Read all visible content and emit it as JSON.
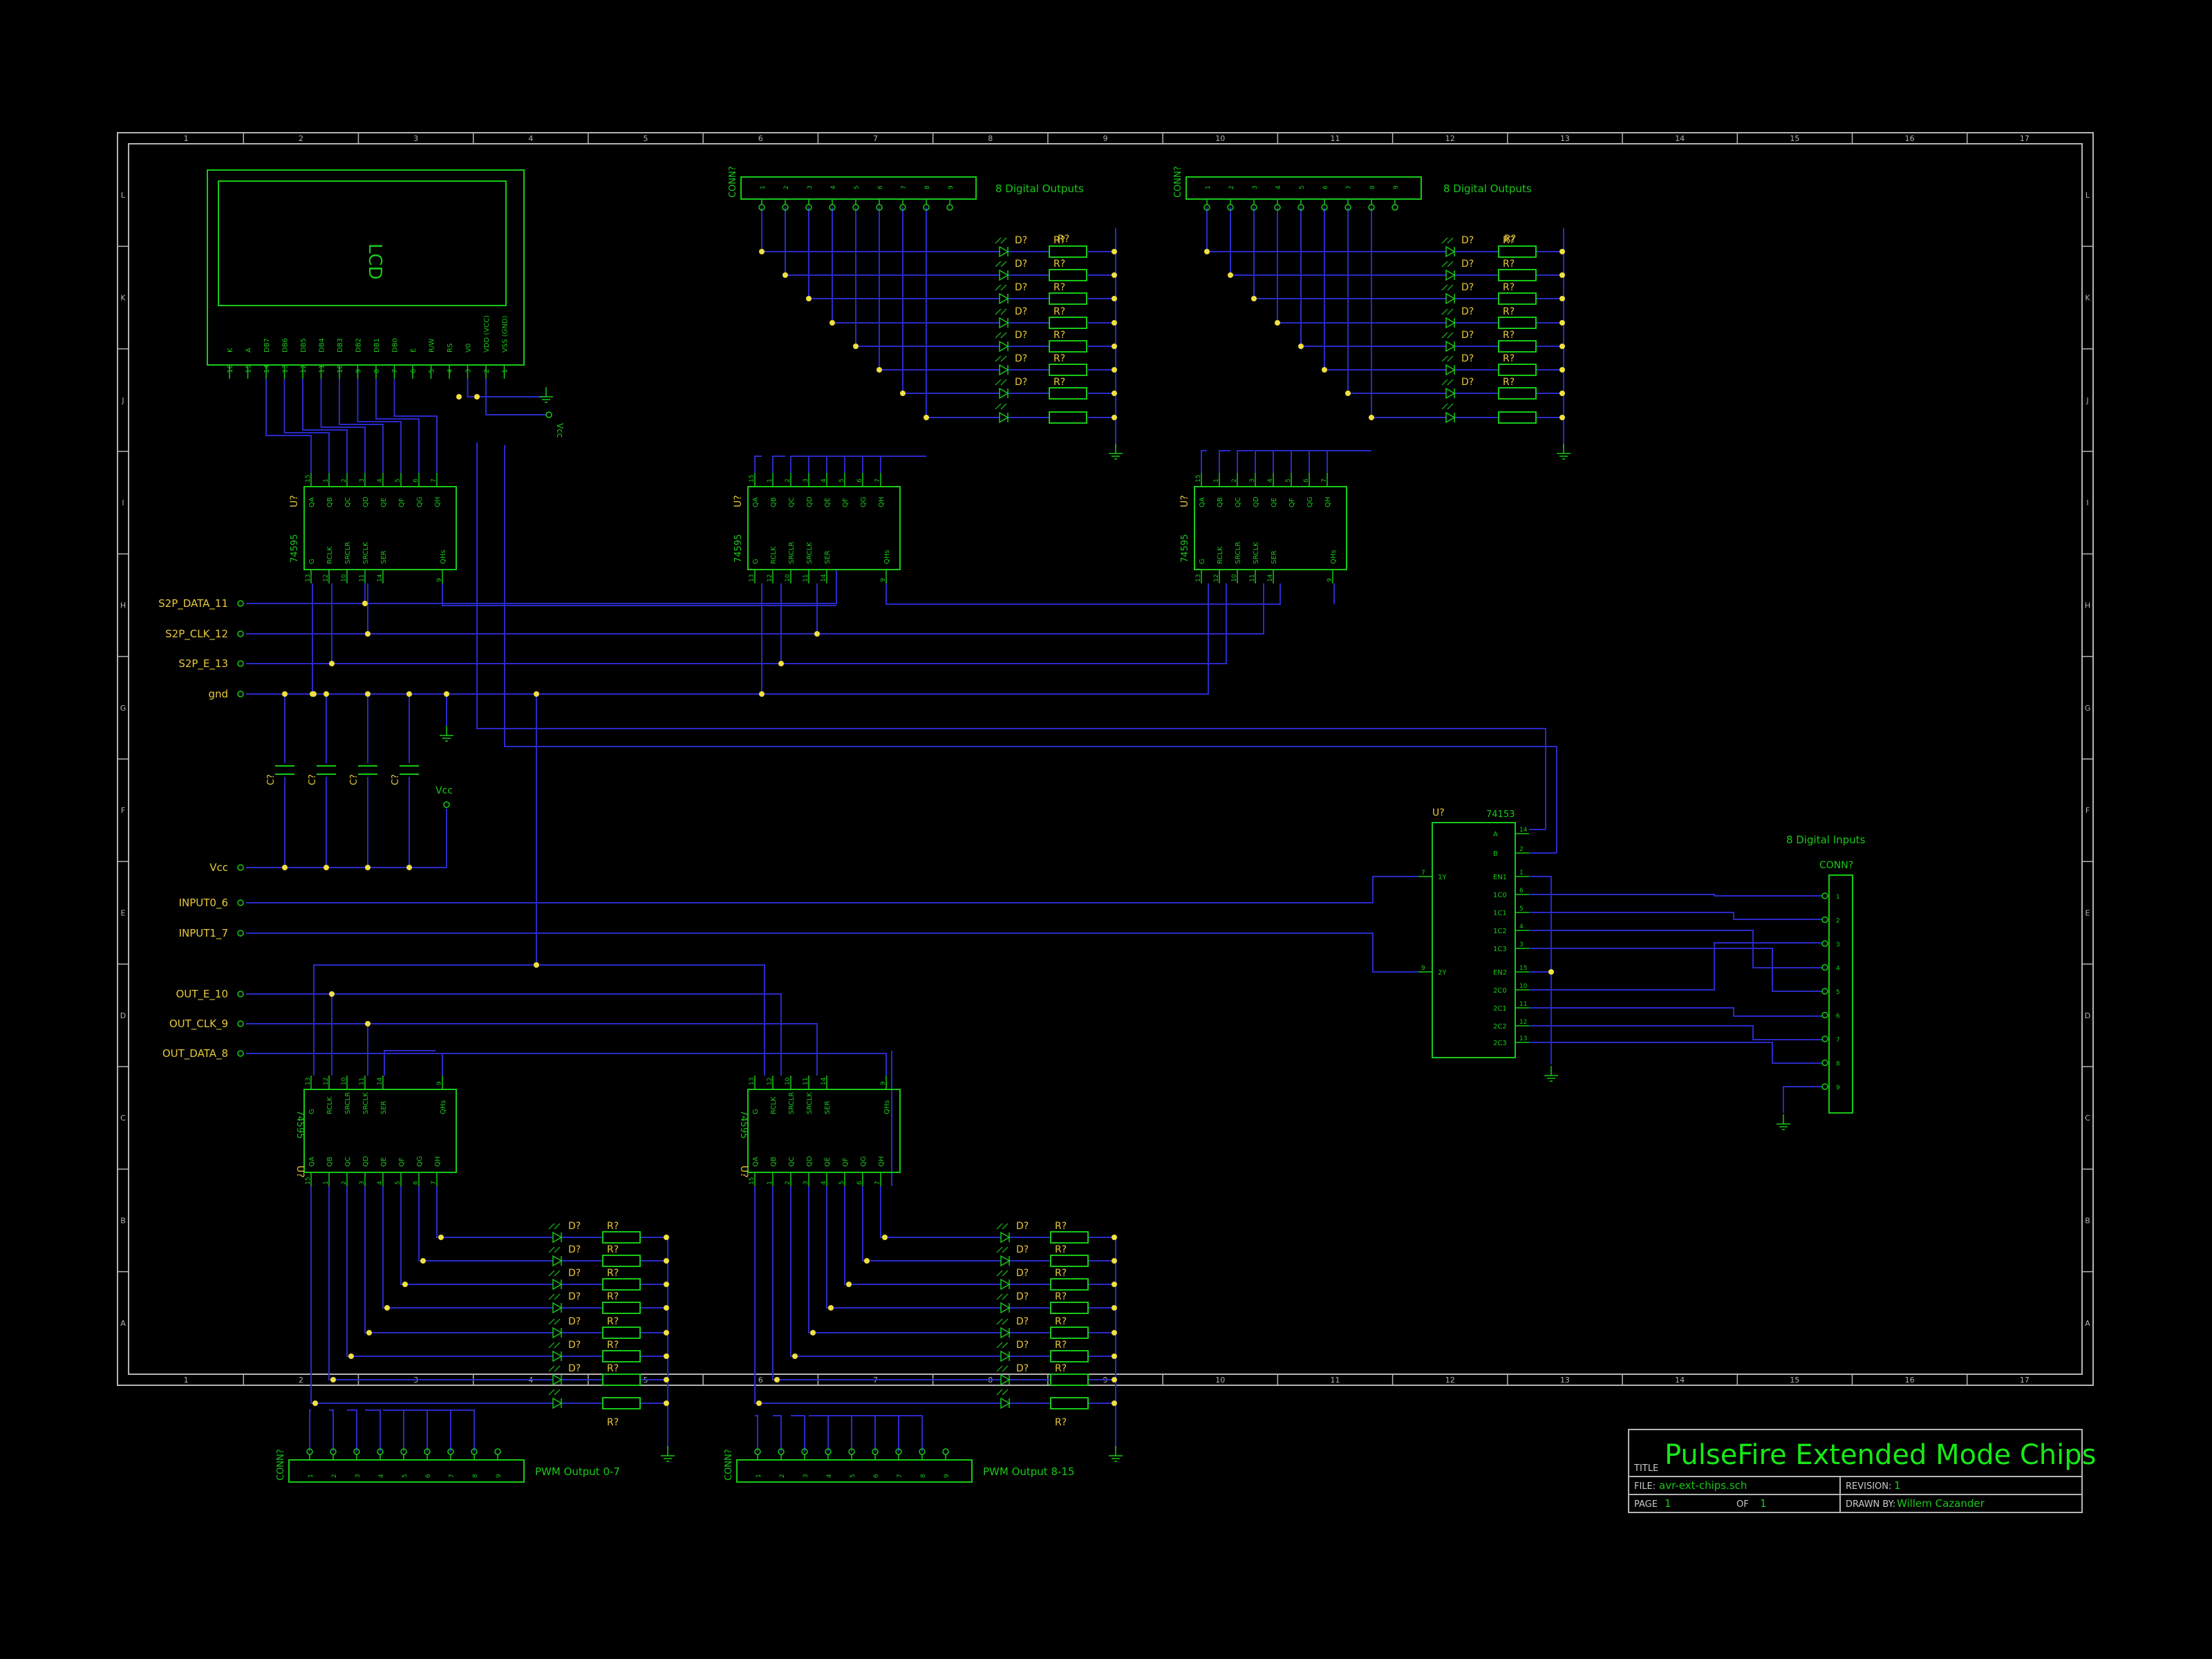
{
  "colors": {
    "background": "#000000",
    "frame": "#b4b4b4",
    "wire": "#2a2ac8",
    "component": "#18c818",
    "label": "#e6c83c",
    "junction": "#f0e040",
    "title": "#18e818",
    "info": "#c8c8c8"
  },
  "grid": {
    "columns": [
      "1",
      "2",
      "3",
      "4",
      "5",
      "6",
      "7",
      "8",
      "9",
      "10",
      "11",
      "12",
      "13",
      "14",
      "15",
      "16",
      "17"
    ],
    "rows": [
      "L",
      "K",
      "J",
      "I",
      "H",
      "G",
      "F",
      "E",
      "D",
      "C",
      "B",
      "A"
    ]
  },
  "labels": {
    "lcd": "LCD",
    "lcd_pins": [
      "16",
      "15",
      "14",
      "13",
      "12",
      "11",
      "10",
      "9",
      "8",
      "7",
      "6",
      "5",
      "4",
      "3",
      "2",
      "1"
    ],
    "lcd_pin_names": [
      "K",
      "A",
      "DB7",
      "DB6",
      "DB5",
      "DB4",
      "DB3",
      "DB2",
      "DB1",
      "DB0",
      "E",
      "R/W",
      "RS",
      "V0",
      "VDD (VCC)",
      "VSS (GND)"
    ],
    "vcc": "Vcc",
    "out8": "8 Digital Outputs",
    "in8": "8 Digital Inputs",
    "conn": "CONN?",
    "conn_pins": [
      "1",
      "2",
      "3",
      "4",
      "5",
      "6",
      "7",
      "8",
      "9"
    ],
    "ref_u": "U?",
    "ref_d": "D?",
    "ref_r": "R?",
    "ref_c": "C?",
    "chip595": "74595",
    "chip153": "74153",
    "pins595_top": [
      "QA",
      "QB",
      "QC",
      "QD",
      "QE",
      "QF",
      "QG",
      "QH"
    ],
    "pins595_top_num": [
      "15",
      "1",
      "2",
      "3",
      "4",
      "5",
      "6",
      "7"
    ],
    "pins595_bot": [
      "G",
      "RCLK",
      "SRCLR",
      "SRCLK",
      "SER",
      "QHs"
    ],
    "pins595_bot_num": [
      "13",
      "12",
      "10",
      "11",
      "14",
      "9"
    ],
    "pins153_left": [
      "1Y",
      "2Y"
    ],
    "pins153_left_num": [
      "7",
      "9"
    ],
    "pins153_right": [
      "A",
      "B",
      "EN1",
      "1C0",
      "1C1",
      "1C2",
      "1C3",
      "EN2",
      "2C0",
      "2C1",
      "2C2",
      "2C3"
    ],
    "pins153_right_num": [
      "14",
      "2",
      "1",
      "6",
      "5",
      "4",
      "3",
      "15",
      "10",
      "11",
      "12",
      "13"
    ],
    "pwm0": "PWM Output 0-7",
    "pwm1": "PWM Output 8-15",
    "ports": [
      "S2P_DATA_11",
      "S2P_CLK_12",
      "S2P_E_13",
      "gnd",
      "Vcc",
      "INPUT0_6",
      "INPUT1_7",
      "OUT_E_10",
      "OUT_CLK_9",
      "OUT_DATA_8"
    ]
  },
  "title_block": {
    "title_label": "TITLE",
    "title": "PulseFire Extended Mode Chips",
    "file_label": "FILE:",
    "file": "avr-ext-chips.sch",
    "revision_label": "REVISION:",
    "revision": "1",
    "page_label": "PAGE",
    "page": "1",
    "of_label": "OF",
    "of": "1",
    "drawn_label": "DRAWN BY:",
    "drawn": "Willem Cazander"
  }
}
